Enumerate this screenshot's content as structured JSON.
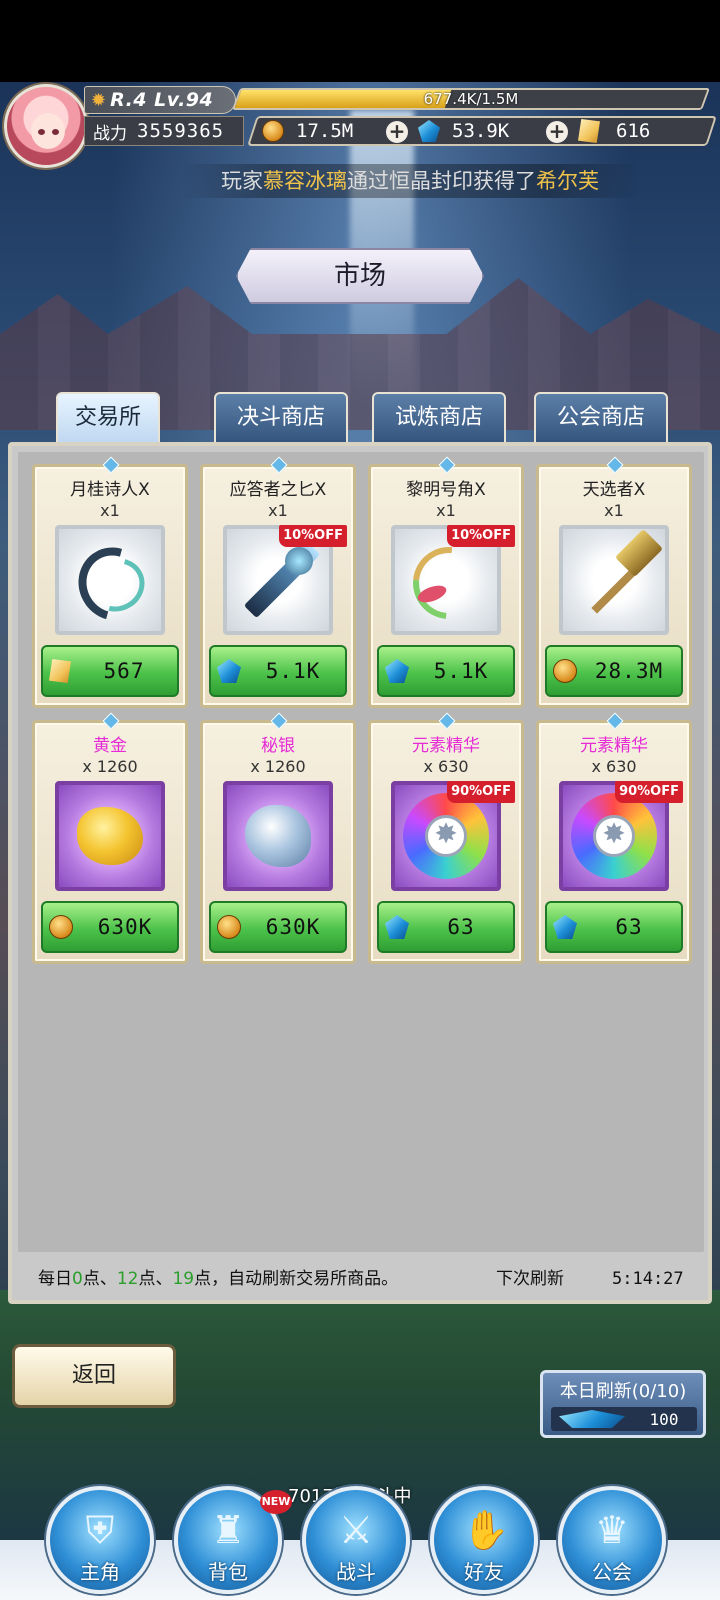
{
  "header": {
    "rank_level": "R.4 Lv.94",
    "exp_text": "677.4K/1.5M",
    "exp_progress": 0.45,
    "power_label": "战力",
    "power_value": "3559365",
    "currencies": [
      {
        "icon": "gold-coin-icon",
        "value": "17.5M"
      },
      {
        "icon": "diamond-icon",
        "value": "53.9K"
      },
      {
        "icon": "ticket-icon",
        "value": "616"
      }
    ],
    "notice": {
      "prefix": "玩家",
      "player": "慕容冰璃",
      "middle": "通过恒晶封印获得了",
      "reward": "希尔芙"
    }
  },
  "title": "市场",
  "tabs": [
    {
      "label": "交易所",
      "active": true
    },
    {
      "label": "决斗商店",
      "active": false
    },
    {
      "label": "试炼商店",
      "active": false
    },
    {
      "label": "公会商店",
      "active": false
    }
  ],
  "items": [
    {
      "name": "月桂诗人X",
      "qty": "x1",
      "price": "567",
      "currency": "ticket-icon",
      "discount": ""
    },
    {
      "name": "应答者之匕X",
      "qty": "x1",
      "price": "5.1K",
      "currency": "diamond-icon",
      "discount": "10%OFF"
    },
    {
      "name": "黎明号角X",
      "qty": "x1",
      "price": "5.1K",
      "currency": "diamond-icon",
      "discount": "10%OFF"
    },
    {
      "name": "天选者X",
      "qty": "x1",
      "price": "28.3M",
      "currency": "gold-coin-icon",
      "discount": ""
    },
    {
      "name": "黄金",
      "qty": "x 1260",
      "price": "630K",
      "currency": "gold-coin-icon",
      "discount": ""
    },
    {
      "name": "秘银",
      "qty": "x 1260",
      "price": "630K",
      "currency": "gold-coin-icon",
      "discount": ""
    },
    {
      "name": "元素精华",
      "qty": "x 630",
      "price": "63",
      "currency": "diamond-icon",
      "discount": "90%OFF"
    },
    {
      "name": "元素精华",
      "qty": "x 630",
      "price": "63",
      "currency": "diamond-icon",
      "discount": "90%OFF"
    }
  ],
  "footer": {
    "part1": "每日",
    "h1": "0",
    "part2": "点、",
    "h2": "12",
    "part3": "点、",
    "h3": "19",
    "part4": "点，自动刷新交易所商品。",
    "next_refresh_label": "下次刷新",
    "next_refresh_time": "5:14:27"
  },
  "back_label": "返回",
  "daily_refresh": {
    "label": "本日刷新(0/10)",
    "cost": "100"
  },
  "battle_status": "7017层 战斗中",
  "nav": [
    {
      "label": "主角",
      "icon": "knight-helmet-icon"
    },
    {
      "label": "背包",
      "icon": "backpack-icon",
      "badge": "NEW"
    },
    {
      "label": "战斗",
      "icon": "crossed-swords-icon"
    },
    {
      "label": "好友",
      "icon": "handshake-icon"
    },
    {
      "label": "公会",
      "icon": "guild-emblem-icon"
    }
  ]
}
